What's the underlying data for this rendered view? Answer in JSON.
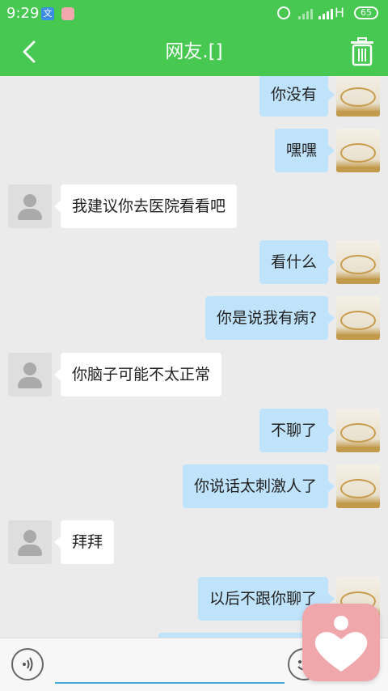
{
  "status_bar": {
    "time": "9:29",
    "app_icon_1": "文",
    "network": "H",
    "battery": "65"
  },
  "header": {
    "title": "网友.[]",
    "back_icon": "chevron-left-icon",
    "delete_icon": "trash-icon"
  },
  "messages": [
    {
      "sender": "me",
      "text": "你没有"
    },
    {
      "sender": "me",
      "text": "嘿嘿"
    },
    {
      "sender": "other",
      "text": "我建议你去医院看看吧"
    },
    {
      "sender": "me",
      "text": "看什么"
    },
    {
      "sender": "me",
      "text": "你是说我有病?"
    },
    {
      "sender": "other",
      "text": "你脑子可能不太正常"
    },
    {
      "sender": "me",
      "text": "不聊了"
    },
    {
      "sender": "me",
      "text": "你说话太刺激人了"
    },
    {
      "sender": "other",
      "text": "拜拜"
    },
    {
      "sender": "me",
      "text": "以后不跟你聊了"
    }
  ],
  "input_bar": {
    "voice_icon": "voice-icon",
    "emoji_icon": "emoji-icon",
    "input_value": ""
  },
  "floating_button_icon": "heart-icon",
  "colors": {
    "header": "#47c850",
    "my_bubble": "#bfe3fb",
    "their_bubble": "#ffffff",
    "background": "#ebebeb",
    "float_button": "#f0a7ab"
  }
}
